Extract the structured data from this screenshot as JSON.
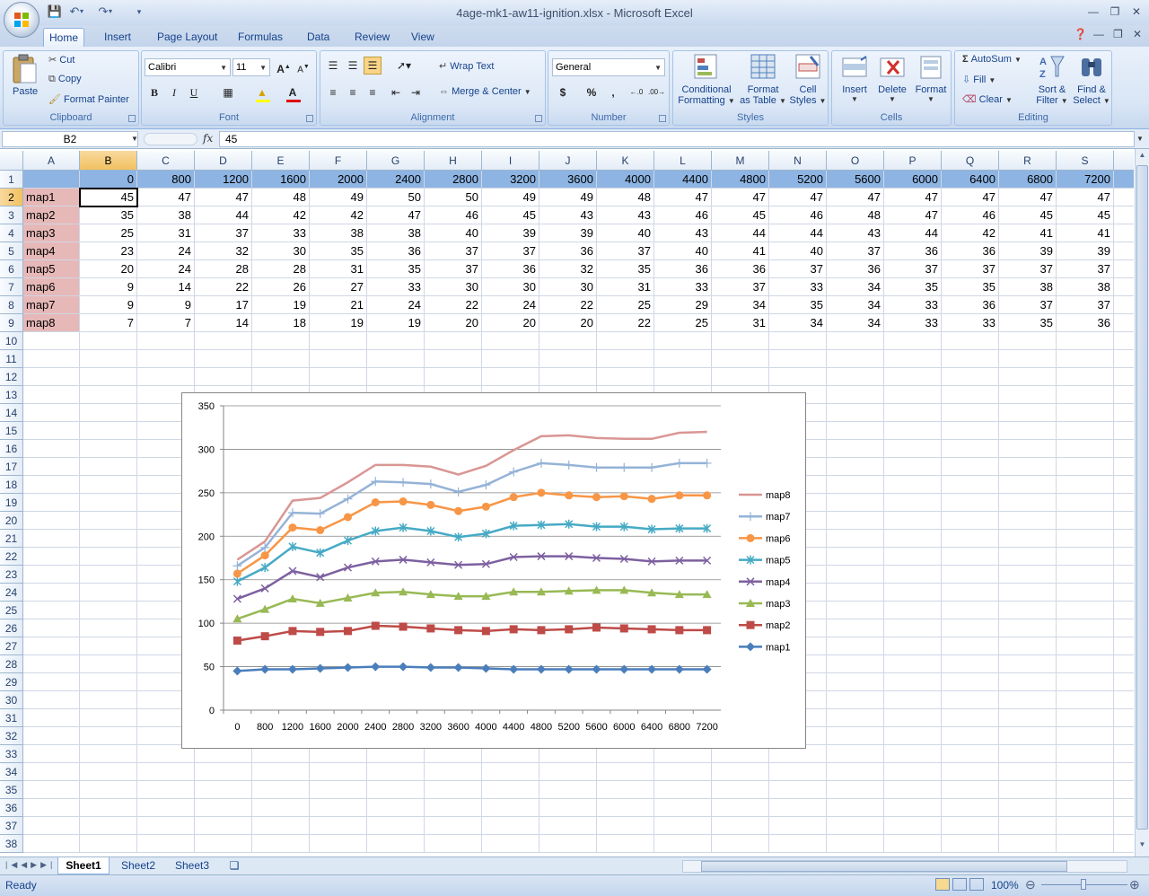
{
  "window": {
    "title": "4age-mk1-aw11-ignition.xlsx - Microsoft Excel"
  },
  "ribbon": {
    "tabs": [
      "Home",
      "Insert",
      "Page Layout",
      "Formulas",
      "Data",
      "Review",
      "View"
    ],
    "clipboard": {
      "paste": "Paste",
      "cut": "Cut",
      "copy": "Copy",
      "format_painter": "Format Painter",
      "label": "Clipboard"
    },
    "font": {
      "name": "Calibri",
      "size": "11",
      "bold": "B",
      "italic": "I",
      "underline": "U",
      "label": "Font"
    },
    "alignment": {
      "wrap_text": "Wrap Text",
      "merge_center": "Merge & Center",
      "label": "Alignment"
    },
    "number": {
      "format": "General",
      "currency": "$",
      "percent": "%",
      "comma": ",",
      "label": "Number"
    },
    "styles": {
      "conditional": "Conditional",
      "conditional2": "Formatting",
      "format_table": "Format",
      "format_table2": "as Table",
      "cell_styles": "Cell",
      "cell_styles2": "Styles",
      "label": "Styles"
    },
    "cells": {
      "insert": "Insert",
      "delete": "Delete",
      "format": "Format",
      "label": "Cells"
    },
    "editing": {
      "autosum": "AutoSum",
      "fill": "Fill",
      "clear": "Clear",
      "sort": "Sort &",
      "sort2": "Filter",
      "find": "Find &",
      "find2": "Select",
      "label": "Editing"
    }
  },
  "formula_bar": {
    "name_box": "B2",
    "fx": "fx",
    "content": "45"
  },
  "sheet": {
    "columns": [
      "A",
      "B",
      "C",
      "D",
      "E",
      "F",
      "G",
      "H",
      "I",
      "J",
      "K",
      "L",
      "M",
      "N",
      "O",
      "P",
      "Q",
      "R",
      "S"
    ],
    "rows": [
      "1",
      "2",
      "3",
      "4",
      "5",
      "6",
      "7",
      "8",
      "9",
      "10",
      "11",
      "12",
      "13",
      "14",
      "15",
      "16",
      "17",
      "18",
      "19",
      "20",
      "21",
      "22",
      "23",
      "24",
      "25",
      "26",
      "27",
      "28",
      "29",
      "30",
      "31",
      "32",
      "33",
      "34",
      "35",
      "36",
      "37",
      "38"
    ],
    "header_values": [
      "0",
      "800",
      "1200",
      "1600",
      "2000",
      "2400",
      "2800",
      "3200",
      "3600",
      "4000",
      "4400",
      "4800",
      "5200",
      "5600",
      "6000",
      "6400",
      "6800",
      "7200"
    ],
    "data": [
      {
        "label": "map1",
        "values": [
          "45",
          "47",
          "47",
          "48",
          "49",
          "50",
          "50",
          "49",
          "49",
          "48",
          "47",
          "47",
          "47",
          "47",
          "47",
          "47",
          "47",
          "47"
        ]
      },
      {
        "label": "map2",
        "values": [
          "35",
          "38",
          "44",
          "42",
          "42",
          "47",
          "46",
          "45",
          "43",
          "43",
          "46",
          "45",
          "46",
          "48",
          "47",
          "46",
          "45",
          "45"
        ]
      },
      {
        "label": "map3",
        "values": [
          "25",
          "31",
          "37",
          "33",
          "38",
          "38",
          "40",
          "39",
          "39",
          "40",
          "43",
          "44",
          "44",
          "43",
          "44",
          "42",
          "41",
          "41"
        ]
      },
      {
        "label": "map4",
        "values": [
          "23",
          "24",
          "32",
          "30",
          "35",
          "36",
          "37",
          "37",
          "36",
          "37",
          "40",
          "41",
          "40",
          "37",
          "36",
          "36",
          "39",
          "39"
        ]
      },
      {
        "label": "map5",
        "values": [
          "20",
          "24",
          "28",
          "28",
          "31",
          "35",
          "37",
          "36",
          "32",
          "35",
          "36",
          "36",
          "37",
          "36",
          "37",
          "37",
          "37",
          "37"
        ]
      },
      {
        "label": "map6",
        "values": [
          "9",
          "14",
          "22",
          "26",
          "27",
          "33",
          "30",
          "30",
          "30",
          "31",
          "33",
          "37",
          "33",
          "34",
          "35",
          "35",
          "38",
          "38"
        ]
      },
      {
        "label": "map7",
        "values": [
          "9",
          "9",
          "17",
          "19",
          "21",
          "24",
          "22",
          "24",
          "22",
          "25",
          "29",
          "34",
          "35",
          "34",
          "33",
          "36",
          "37",
          "37"
        ]
      },
      {
        "label": "map8",
        "values": [
          "7",
          "7",
          "14",
          "18",
          "19",
          "19",
          "20",
          "20",
          "20",
          "22",
          "25",
          "31",
          "34",
          "34",
          "33",
          "33",
          "35",
          "36"
        ]
      }
    ],
    "tabs": [
      "Sheet1",
      "Sheet2",
      "Sheet3"
    ]
  },
  "chart_data": {
    "type": "line",
    "stacked": true,
    "categories": [
      "0",
      "800",
      "1200",
      "1600",
      "2000",
      "2400",
      "2800",
      "3200",
      "3600",
      "4000",
      "4400",
      "4800",
      "5200",
      "5600",
      "6000",
      "6400",
      "6800",
      "7200"
    ],
    "ylim": [
      0,
      350
    ],
    "yticks": [
      "0",
      "50",
      "100",
      "150",
      "200",
      "250",
      "300",
      "350"
    ],
    "grid": true,
    "legend": "right",
    "series": [
      {
        "name": "map1",
        "color": "#4a7ebb",
        "marker": "diamond",
        "values": [
          45,
          47,
          47,
          48,
          49,
          50,
          50,
          49,
          49,
          48,
          47,
          47,
          47,
          47,
          47,
          47,
          47,
          47
        ]
      },
      {
        "name": "map2",
        "color": "#be4b48",
        "marker": "square",
        "values": [
          35,
          38,
          44,
          42,
          42,
          47,
          46,
          45,
          43,
          43,
          46,
          45,
          46,
          48,
          47,
          46,
          45,
          45
        ]
      },
      {
        "name": "map3",
        "color": "#98b954",
        "marker": "triangle",
        "values": [
          25,
          31,
          37,
          33,
          38,
          38,
          40,
          39,
          39,
          40,
          43,
          44,
          44,
          43,
          44,
          42,
          41,
          41
        ]
      },
      {
        "name": "map4",
        "color": "#7d60a0",
        "marker": "x",
        "values": [
          23,
          24,
          32,
          30,
          35,
          36,
          37,
          37,
          36,
          37,
          40,
          41,
          40,
          37,
          36,
          36,
          39,
          39
        ]
      },
      {
        "name": "map5",
        "color": "#46aac5",
        "marker": "star",
        "values": [
          20,
          24,
          28,
          28,
          31,
          35,
          37,
          36,
          32,
          35,
          36,
          36,
          37,
          36,
          37,
          37,
          37,
          37
        ]
      },
      {
        "name": "map6",
        "color": "#f79646",
        "marker": "circle",
        "values": [
          9,
          14,
          22,
          26,
          27,
          33,
          30,
          30,
          30,
          31,
          33,
          37,
          33,
          34,
          35,
          35,
          38,
          38
        ]
      },
      {
        "name": "map7",
        "color": "#95b3d7",
        "marker": "plus",
        "values": [
          9,
          9,
          17,
          19,
          21,
          24,
          22,
          24,
          22,
          25,
          29,
          34,
          35,
          34,
          33,
          36,
          37,
          37
        ]
      },
      {
        "name": "map8",
        "color": "#d99694",
        "marker": "none",
        "values": [
          7,
          7,
          14,
          18,
          19,
          19,
          20,
          20,
          20,
          22,
          25,
          31,
          34,
          34,
          33,
          33,
          35,
          36
        ]
      }
    ]
  },
  "status": {
    "ready": "Ready",
    "zoom": "100%"
  }
}
